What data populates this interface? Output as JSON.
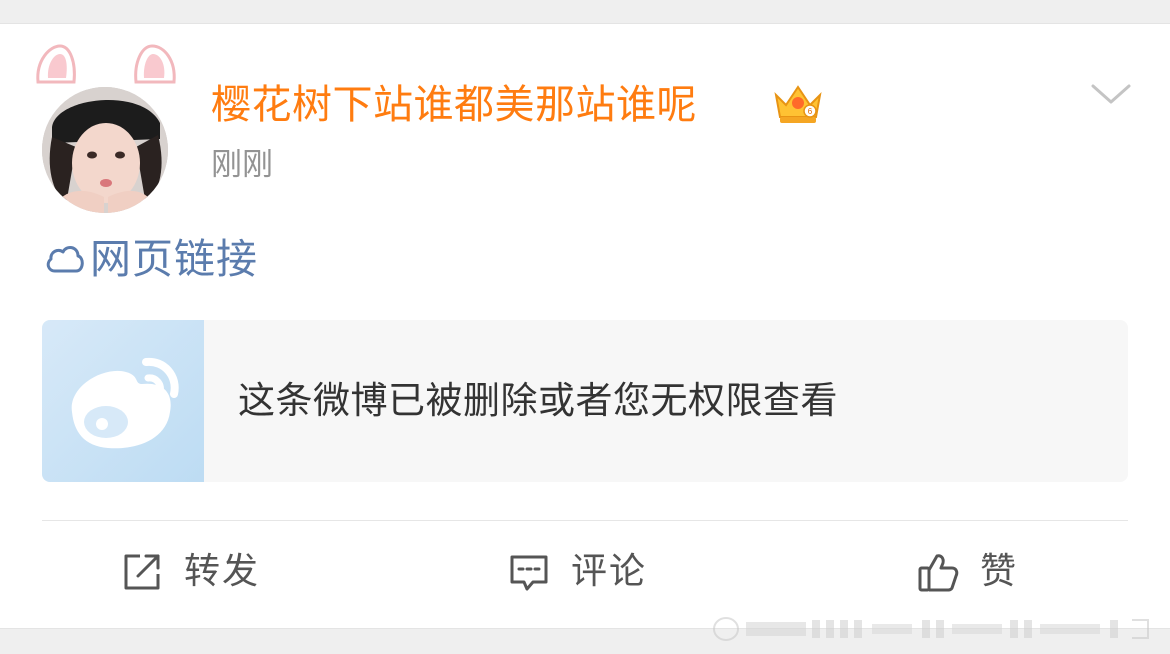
{
  "post": {
    "author": {
      "name": "樱花树下站谁都美那站谁呢",
      "badge_icon": "crown-badge-icon"
    },
    "timestamp": "刚刚",
    "link": {
      "icon": "cloud-link-icon",
      "label": "网页链接"
    },
    "deleted_notice": {
      "thumbnail_icon": "weibo-logo-icon",
      "text": "这条微博已被删除或者您无权限查看"
    },
    "actions": {
      "repost": {
        "icon": "repost-icon",
        "label": "转发"
      },
      "comment": {
        "icon": "comment-icon",
        "label": "评论"
      },
      "like": {
        "icon": "thumbs-up-icon",
        "label": "赞"
      }
    }
  },
  "colors": {
    "username": "#ff7c10",
    "link": "#5b7cad",
    "timestamp": "#939393",
    "body_text": "#333333",
    "action_text": "#555555",
    "page_gap": "#efefef"
  }
}
